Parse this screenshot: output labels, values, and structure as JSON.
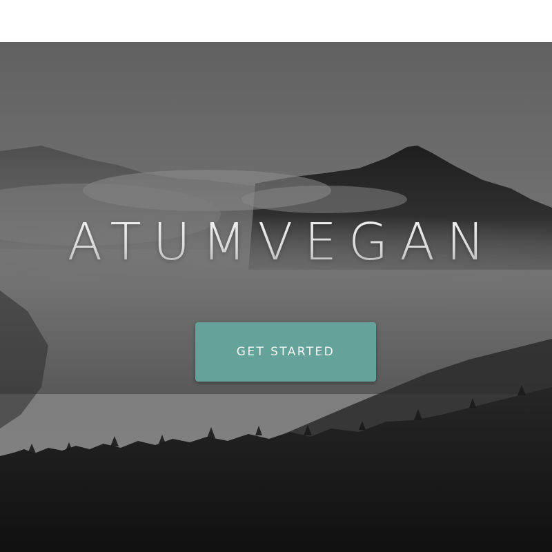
{
  "hero": {
    "brand_title": "ATUMVEGAN",
    "cta_label": "GET STARTED",
    "background": "misty-mountains-monochrome-photo"
  },
  "colors": {
    "page_background": "#ffffff",
    "cta_background": "#64a29a",
    "cta_text": "#f4f8f7",
    "brand_text": "#e9e9e9"
  }
}
